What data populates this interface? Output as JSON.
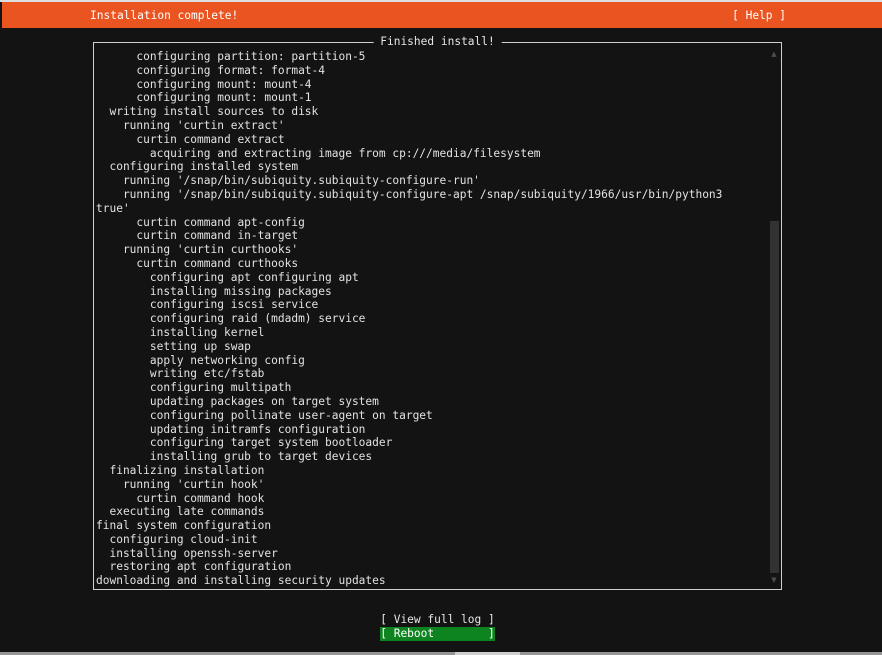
{
  "header": {
    "title": "Installation complete!",
    "help_label": "[ Help ]"
  },
  "panel": {
    "title": "Finished install!"
  },
  "log_lines": [
    "      configuring partition: partition-5",
    "      configuring format: format-4",
    "      configuring mount: mount-4",
    "      configuring mount: mount-1",
    "  writing install sources to disk",
    "    running 'curtin extract'",
    "      curtin command extract",
    "        acquiring and extracting image from cp:///media/filesystem",
    "  configuring installed system",
    "    running '/snap/bin/subiquity.subiquity-configure-run'",
    "    running '/snap/bin/subiquity.subiquity-configure-apt /snap/subiquity/1966/usr/bin/python3",
    "true'",
    "      curtin command apt-config",
    "      curtin command in-target",
    "    running 'curtin curthooks'",
    "      curtin command curthooks",
    "        configuring apt configuring apt",
    "        installing missing packages",
    "        configuring iscsi service",
    "        configuring raid (mdadm) service",
    "        installing kernel",
    "        setting up swap",
    "        apply networking config",
    "        writing etc/fstab",
    "        configuring multipath",
    "        updating packages on target system",
    "        configuring pollinate user-agent on target",
    "        updating initramfs configuration",
    "        configuring target system bootloader",
    "        installing grub to target devices",
    "  finalizing installation",
    "    running 'curtin hook'",
    "      curtin command hook",
    "  executing late commands",
    "final system configuration",
    "  configuring cloud-init",
    "  installing openssh-server",
    "  restoring apt configuration",
    "downloading and installing security updates"
  ],
  "scrollbar": {
    "up_icon": "▲",
    "down_icon": "▼"
  },
  "footer": {
    "view_full_log_label": "[ View full log ]",
    "reboot_label": "[ Reboot        ]"
  },
  "colors": {
    "header_bg": "#e95420",
    "background": "#131313",
    "text": "#e2e2e2",
    "accent_green": "#0e8420",
    "border": "#cfcfcf"
  }
}
